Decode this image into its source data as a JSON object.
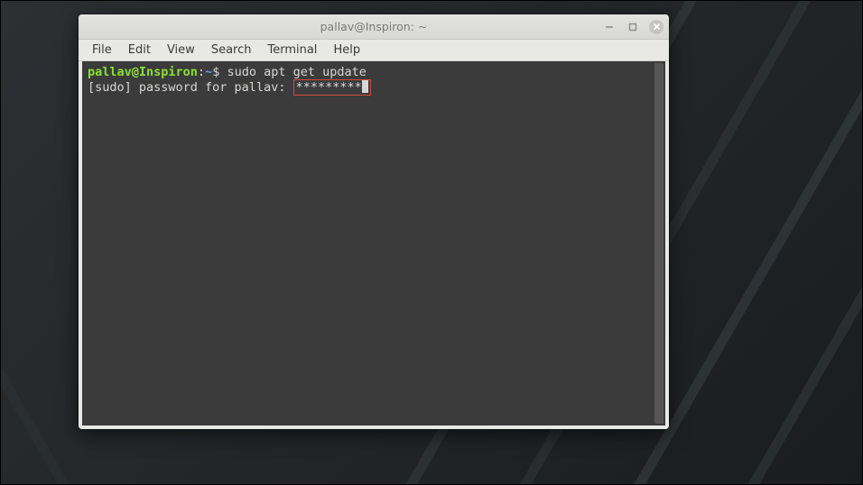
{
  "window": {
    "title": "pallav@Inspiron: ~"
  },
  "menubar": {
    "items": [
      "File",
      "Edit",
      "View",
      "Search",
      "Terminal",
      "Help"
    ]
  },
  "terminal": {
    "prompt": {
      "user_host": "pallav@Inspiron",
      "colon": ":",
      "path": "~",
      "symbol": "$ "
    },
    "command": "sudo apt get update",
    "password_prompt_prefix": "[sudo] password for pallav: ",
    "password_masked": "*********"
  }
}
